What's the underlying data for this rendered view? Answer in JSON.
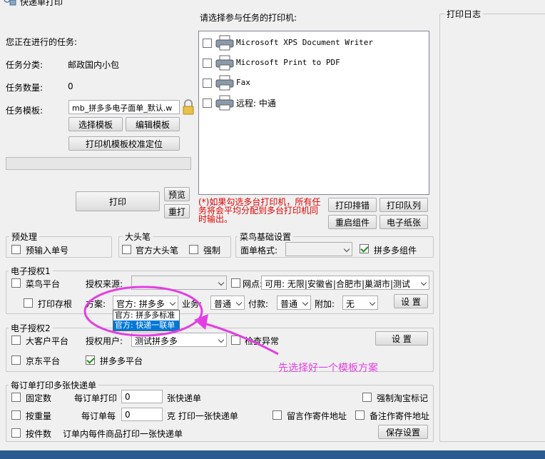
{
  "window": {
    "title": "快递单打印"
  },
  "task": {
    "current_label": "您正在进行的任务:",
    "category_label": "任务分类:",
    "category_value": "邮政国内小包",
    "count_label": "任务数量:",
    "count_value": "0",
    "template_label": "任务模板:",
    "template_value": "mb_拼多多电子面单_默认.w",
    "select_template": "选择模板",
    "edit_template": "编辑模板",
    "calibrate": "打印机模板校准定位",
    "progress": 0
  },
  "print_buttons": {
    "print": "打印",
    "preview": "预览",
    "reprint": "重打"
  },
  "printers": {
    "label": "请选择参与任务的打印机:",
    "items": [
      {
        "name": "Microsoft XPS Document Writer",
        "checked": false
      },
      {
        "name": "Microsoft Print to PDF",
        "checked": false
      },
      {
        "name": "Fax",
        "checked": false
      },
      {
        "name": "远程: 中通",
        "checked": false
      }
    ],
    "note": "(*)如果勾选多台打印机，所有任务将会平均分配到多台打印机同时输出。",
    "sort": "打印排错",
    "queue": "打印队列",
    "restart": "重启组件",
    "paper": "电子纸张"
  },
  "log": {
    "title": "打印日志"
  },
  "preprocess": {
    "title": "预处理",
    "preinput": "预输入单号"
  },
  "bigpen": {
    "title": "大头笔",
    "official": "官方大头笔",
    "force": "强制"
  },
  "cainiao": {
    "title": "菜鸟基础设置",
    "format_label": "面单格式:",
    "format_value": "",
    "pdd_component": "拼多多组件"
  },
  "auth1": {
    "title": "电子授权1",
    "cainiao_platform": "菜鸟平台",
    "source_label": "授权来源:",
    "source_value": "",
    "site_label": "网点:",
    "site_value": "可用: 无限|安徽省|合肥市|巢湖市|测试",
    "print_stub": "打印存根",
    "scheme_label": "方案:",
    "scheme_value": "官方: 拼多多",
    "dropdown_options": [
      "官方: 拼多多标准",
      "官方: 快递一联单"
    ],
    "business_label": "业务:",
    "business_value": "普通",
    "payment_label": "付款:",
    "payment_value": "普通",
    "addon_label": "附加:",
    "addon_value": "无",
    "settings": "设 置"
  },
  "auth2": {
    "title": "电子授权2",
    "big_customer": "大客户平台",
    "user_label": "授权用户:",
    "user_value": "测试拼多多",
    "check_abnormal": "检查异常",
    "settings": "设 置",
    "jd": "京东平台",
    "pdd": "拼多多平台"
  },
  "annotation": {
    "text": "先选择好一个模板方案",
    "color": "#e33ee3"
  },
  "multi": {
    "title": "每订单打印多张快递单",
    "fixed": "固定数",
    "per_order_print": "每订单打印",
    "per_order_print_value": "0",
    "unit_sheets": "张快递单",
    "force_taobao": "强制淘宝标记",
    "by_weight": "按重量",
    "per_order_every": "每订单每",
    "per_order_every_value": "0",
    "unit_weight": "克 打印一张快递单",
    "remark_sender": "留言作寄件地址",
    "note_sender": "备注作寄件地址",
    "by_item": "按件数",
    "item_desc": "订单内每件商品打印一张快递单",
    "save": "保存设置"
  }
}
